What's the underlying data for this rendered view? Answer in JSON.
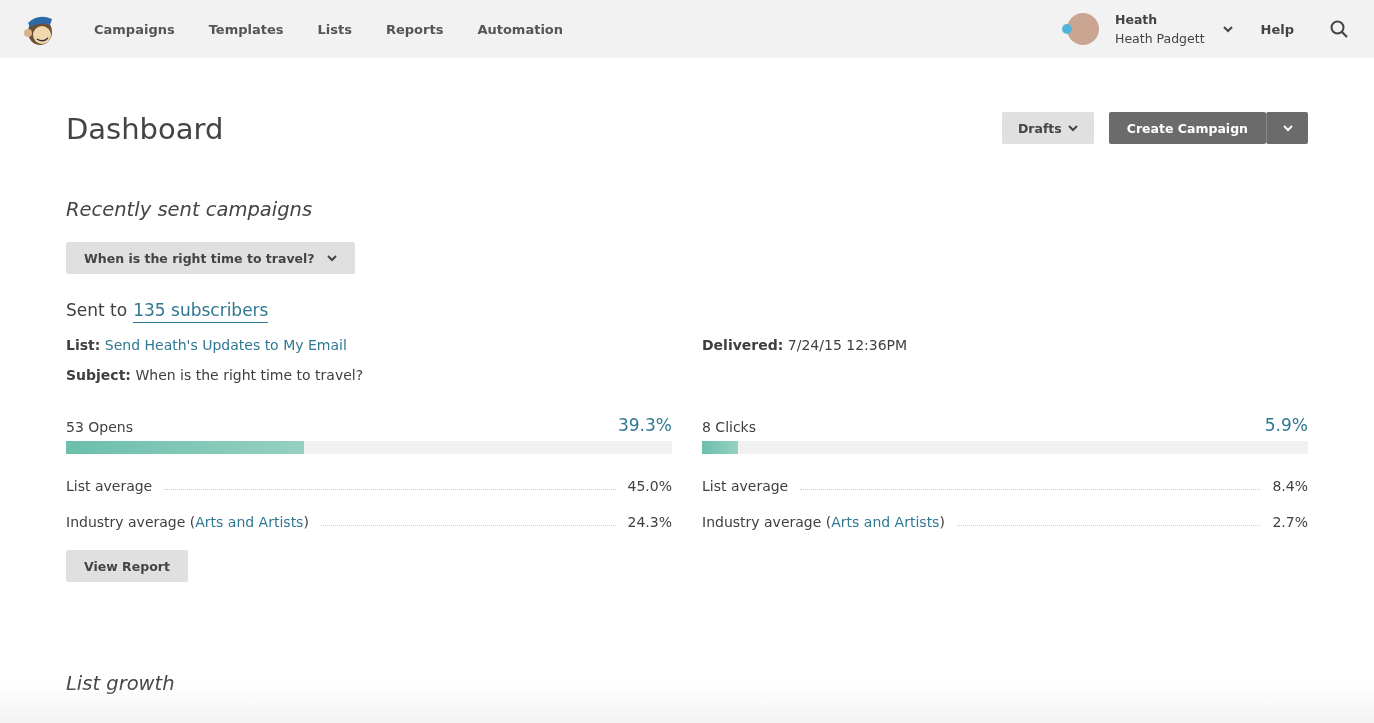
{
  "nav": {
    "items": [
      {
        "label": "Campaigns"
      },
      {
        "label": "Templates"
      },
      {
        "label": "Lists"
      },
      {
        "label": "Reports"
      },
      {
        "label": "Automation"
      }
    ],
    "user": {
      "name": "Heath",
      "full_name": "Heath Padgett",
      "online": true
    },
    "help": "Help"
  },
  "page": {
    "title": "Dashboard",
    "drafts_button": "Drafts",
    "create_button": "Create Campaign"
  },
  "recent": {
    "heading": "Recently sent campaigns",
    "campaign_select": "When is the right time to travel?",
    "sent_prefix": "Sent to",
    "sent_link": "135 subscribers",
    "list_label": "List:",
    "list_value": "Send Heath's Updates to My Email",
    "delivered_label": "Delivered:",
    "delivered_value": "7/24/15 12:36PM",
    "subject_label": "Subject:",
    "subject_value": "When is the right time to travel?",
    "metrics": [
      {
        "label": "53 Opens",
        "percent": "39.3%",
        "level": 0.393,
        "rows": [
          {
            "prefix": "List average",
            "value": "45.0%"
          },
          {
            "prefix": "Industry average (",
            "link": "Arts and Artists",
            "suffix": ")",
            "value": "24.3%"
          }
        ]
      },
      {
        "label": "8 Clicks",
        "percent": "5.9%",
        "level": 0.059,
        "rows": [
          {
            "prefix": "List average",
            "value": "8.4%"
          },
          {
            "prefix": "Industry average (",
            "link": "Arts and Artists",
            "suffix": ")",
            "value": "2.7%"
          }
        ]
      }
    ],
    "report_button": "View Report"
  },
  "growth": {
    "heading": "List growth"
  }
}
